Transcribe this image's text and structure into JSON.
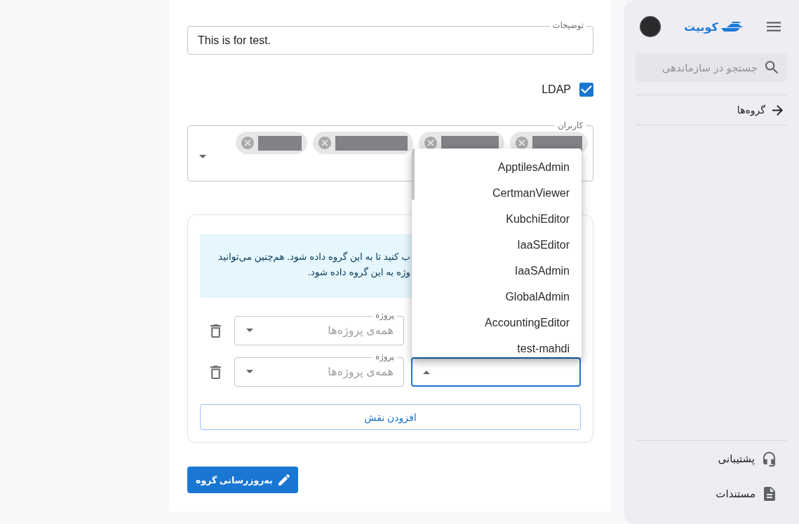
{
  "sidebar": {
    "brand": "کوبیت",
    "search": {
      "placeholder": "جستجو در سازماندهی"
    },
    "nav_items": [
      {
        "label": "گروه‌ها"
      }
    ],
    "footer_items": [
      {
        "label": "پشتیبانی",
        "kind": "support"
      },
      {
        "label": "مستندات",
        "kind": "docs"
      }
    ]
  },
  "form": {
    "description": {
      "label": "توضیحات",
      "value": "This is for test."
    },
    "ldap": {
      "label": "LDAP",
      "checked": true
    },
    "users": {
      "label": "کاربران",
      "chips": [
        {
          "kind": "redacted"
        },
        {
          "kind": "redacted"
        },
        {
          "kind": "redacted"
        },
        {
          "kind": "redacted"
        }
      ]
    },
    "roles": {
      "info_lines": [
        "ب کنید تا به این گروه داده شود. هم‌چنین می‌توانید",
        "وژه به این گروه داده شود."
      ],
      "rows": [
        {
          "project": {
            "label": "پروژه",
            "placeholder": "همه‌ی پروژه‌ها"
          }
        },
        {
          "project": {
            "label": "پروژه",
            "placeholder": "همه‌ی پروژه‌ها"
          },
          "role": {
            "open": true
          }
        }
      ],
      "add_button": "افزودن نقش"
    },
    "submit_button": "به‌روزرسانی گروه"
  },
  "role_menu": {
    "items": [
      "ApptilesAdmin",
      "CertmanViewer",
      "KubchiEditor",
      "IaaSEditor",
      "IaaSAdmin",
      "GlobalAdmin",
      "AccountingEditor",
      "test-mahdi"
    ]
  }
}
